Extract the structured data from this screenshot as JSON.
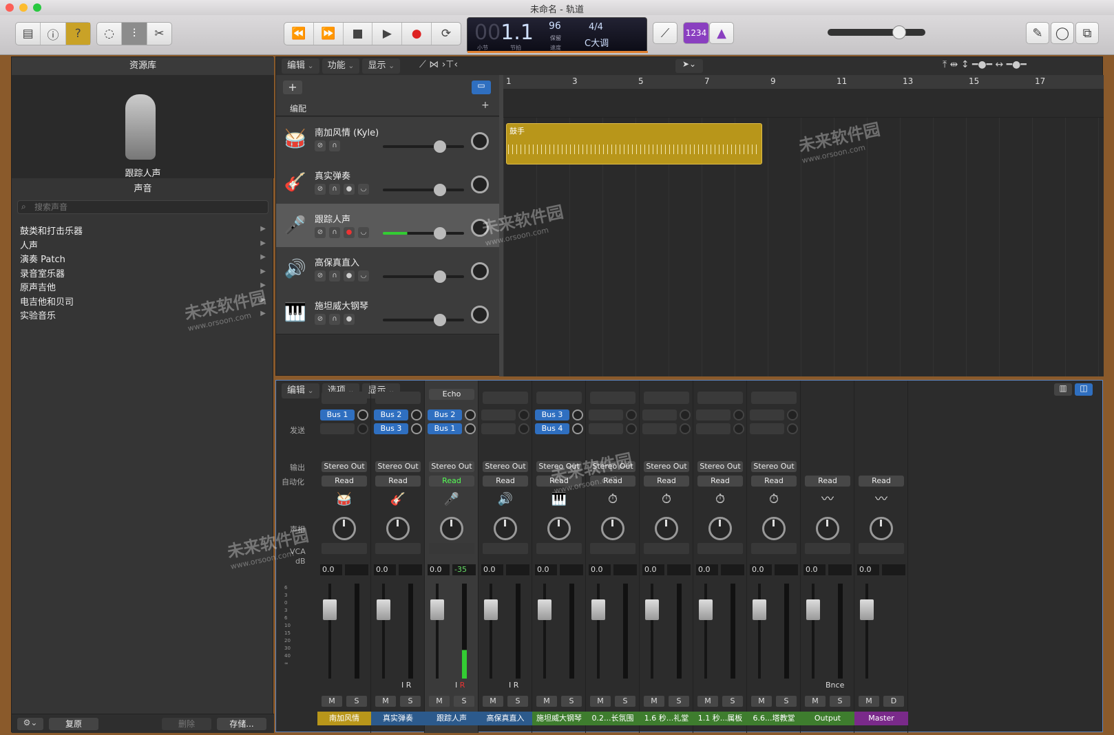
{
  "window": {
    "title": "未命名 - 轨道"
  },
  "toolbar": {
    "lcd": {
      "bar": "1",
      "beat": "1",
      "bar_label": "小节",
      "beat_label": "节拍",
      "tempo": "96",
      "tempo_sub": "保留",
      "tempo_label": "速度",
      "sig": "4/4",
      "key": "C大调"
    },
    "count_in": "1234"
  },
  "library": {
    "title": "资源库",
    "preset_name": "跟踪人声",
    "sounds_title": "声音",
    "search_placeholder": "搜索声音",
    "items": [
      "鼓类和打击乐器",
      "人声",
      "演奏 Patch",
      "录音室乐器",
      "原声吉他",
      "电吉他和贝司",
      "实验音乐"
    ],
    "restore": "复原",
    "delete": "删除",
    "save": "存储..."
  },
  "tracks_area": {
    "menus": [
      "编辑",
      "功能",
      "显示"
    ],
    "arrange_label": "编配",
    "ruler": [
      "1",
      "3",
      "5",
      "7",
      "9",
      "11",
      "13",
      "15",
      "17"
    ],
    "region_name": "鼓手",
    "tracks": [
      {
        "name": "南加风情 (Kyle)",
        "icon": "🥁"
      },
      {
        "name": "真实弹奏",
        "icon": "🎸"
      },
      {
        "name": "跟踪人声",
        "icon": "🎤"
      },
      {
        "name": "高保真直入",
        "icon": "🔊"
      },
      {
        "name": "施坦威大钢琴",
        "icon": "🎹"
      }
    ]
  },
  "mixer": {
    "menus": [
      "编辑",
      "选项",
      "显示"
    ],
    "row_labels": {
      "sends": "发送",
      "output": "输出",
      "automation": "自动化",
      "pan": "声相",
      "vca": "VCA",
      "db": "dB"
    },
    "echo": "Echo",
    "strips": [
      {
        "name": "南加风情",
        "color": "#b8961a",
        "sends": [
          "Bus 1"
        ],
        "out": "Stereo Out",
        "auto": "Read",
        "db": "0.0",
        "icon": "🥁"
      },
      {
        "name": "真实弹奏",
        "color": "#2c5a8c",
        "sends": [
          "Bus 2",
          "Bus 3"
        ],
        "out": "Stereo Out",
        "auto": "Read",
        "db": "0.0",
        "icon": "🎸"
      },
      {
        "name": "跟踪人声",
        "color": "#2c5a8c",
        "sends": [
          "Bus 2",
          "Bus 1"
        ],
        "out": "Stereo Out",
        "auto": "Read",
        "db": "0.0",
        "peak": "-35",
        "icon": "🎤"
      },
      {
        "name": "高保真直入",
        "color": "#2c5a8c",
        "sends": [],
        "out": "Stereo Out",
        "auto": "Read",
        "db": "0.0",
        "icon": "🔊"
      },
      {
        "name": "施坦威大钢琴",
        "color": "#3e7d2e",
        "sends": [
          "Bus 3",
          "Bus 4"
        ],
        "out": "Stereo Out",
        "auto": "Read",
        "db": "0.0",
        "icon": "🎹"
      },
      {
        "name": "0.2...长氛围",
        "color": "#3e7d2e",
        "sends": [],
        "out": "Stereo Out",
        "auto": "Read",
        "db": "0.0",
        "icon": "⏱"
      },
      {
        "name": "1.6 秒...礼堂",
        "color": "#3e7d2e",
        "sends": [],
        "out": "Stereo Out",
        "auto": "Read",
        "db": "0.0",
        "icon": "⏱"
      },
      {
        "name": "1.1 秒...属板",
        "color": "#3e7d2e",
        "sends": [],
        "out": "Stereo Out",
        "auto": "Read",
        "db": "0.0",
        "icon": "⏱"
      },
      {
        "name": "6.6...塔教堂",
        "color": "#3e7d2e",
        "sends": [],
        "out": "Stereo Out",
        "auto": "Read",
        "db": "0.0",
        "icon": "⏱"
      },
      {
        "name": "Output",
        "color": "#3e7d2e",
        "sends": [],
        "out": "",
        "auto": "Read",
        "db": "0.0",
        "bnce": "Bnce",
        "icon": "〰"
      },
      {
        "name": "Master",
        "color": "#7a2a8a",
        "sends": [],
        "out": "",
        "auto": "Read",
        "db": "0.0",
        "icon": "〰"
      }
    ]
  },
  "watermark": {
    "text": "未来软件园",
    "url": "www.orsoon.com"
  }
}
